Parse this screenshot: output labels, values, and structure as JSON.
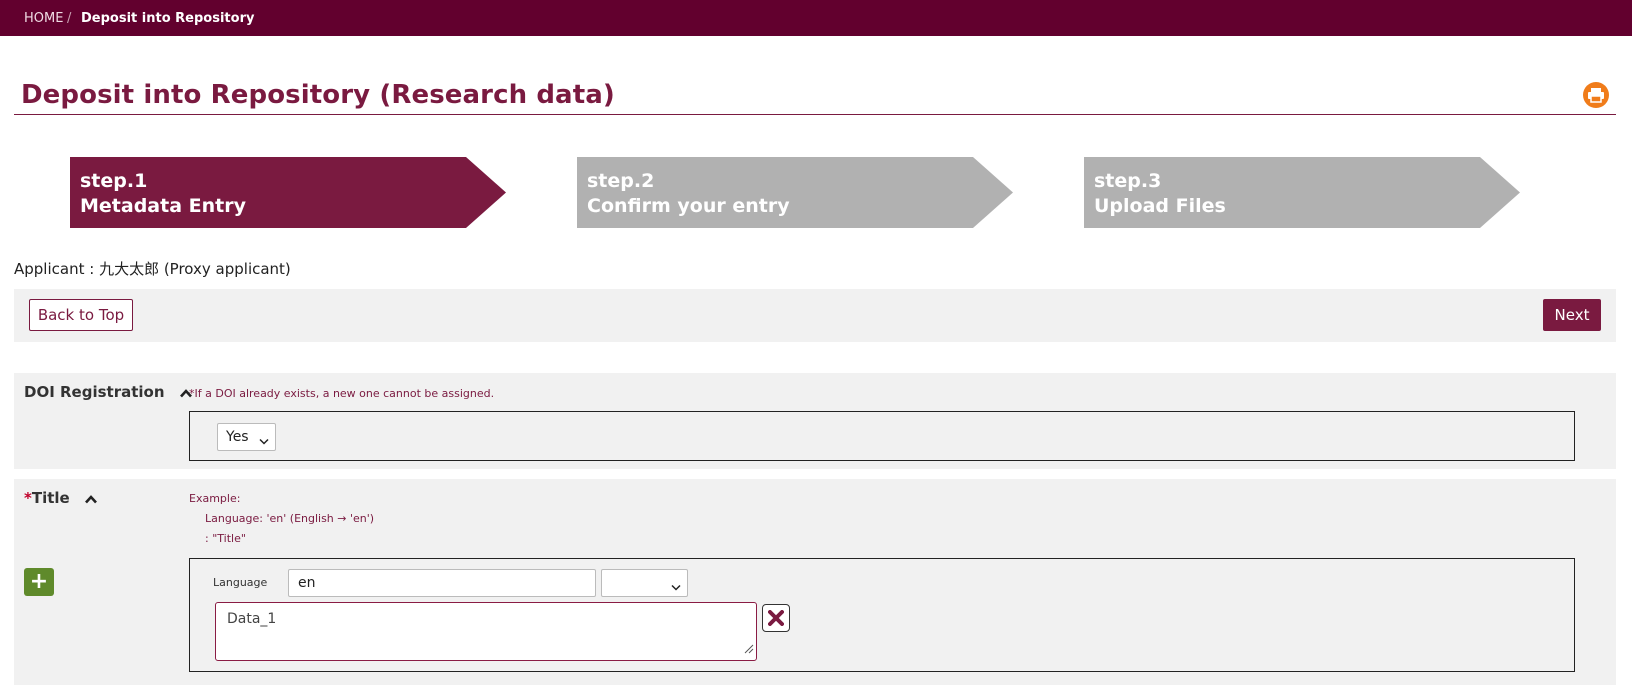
{
  "breadcrumb": {
    "home": "HOME",
    "separator": "/",
    "current": "Deposit into Repository"
  },
  "page": {
    "title": "Deposit into Repository (Research data)",
    "print_icon": "printer-icon"
  },
  "steps": [
    {
      "number": "step.1",
      "label": "Metadata Entry",
      "active": true
    },
    {
      "number": "step.2",
      "label": "Confirm your entry",
      "active": false
    },
    {
      "number": "step.3",
      "label": "Upload Files",
      "active": false
    }
  ],
  "applicant": {
    "label": "Applicant : ",
    "value": "九大太郎 (Proxy applicant)"
  },
  "toolbar": {
    "back_label": "Back to Top",
    "next_label": "Next"
  },
  "doi_section": {
    "label": "DOI Registration",
    "note": "*If a DOI already exists, a new one cannot be assigned.",
    "select_value": "Yes"
  },
  "title_section": {
    "required_mark": "*",
    "label": "Title",
    "example_heading": "Example:",
    "example_line1": "Language: 'en' (English → 'en')",
    "example_line2": ": \"Title\"",
    "add_label": "+",
    "language_label": "Language",
    "language_value": "en",
    "language_select_value": "",
    "title_value": "Data_1"
  },
  "colors": {
    "brand": "#62002e",
    "accent": "#7a1a40",
    "step_inactive": "#b1b1b1",
    "add_button": "#5f8a2b",
    "print_icon": "#f07c1a"
  }
}
